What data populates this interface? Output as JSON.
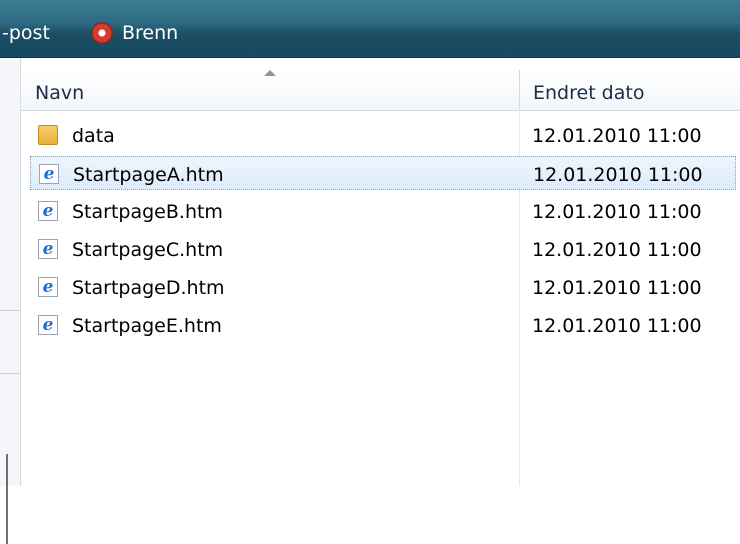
{
  "toolbar": {
    "post_label": "-post",
    "burn_label": "Brenn"
  },
  "columns": {
    "name": "Navn",
    "date": "Endret dato"
  },
  "rows": [
    {
      "name": "data",
      "date": "12.01.2010 11:00",
      "icon": "folder-icon",
      "selected": false
    },
    {
      "name": "StartpageA.htm",
      "date": "12.01.2010 11:00",
      "icon": "ie-document-icon",
      "selected": true
    },
    {
      "name": "StartpageB.htm",
      "date": "12.01.2010 11:00",
      "icon": "ie-document-icon",
      "selected": false
    },
    {
      "name": "StartpageC.htm",
      "date": "12.01.2010 11:00",
      "icon": "ie-document-icon",
      "selected": false
    },
    {
      "name": "StartpageD.htm",
      "date": "12.01.2010 11:00",
      "icon": "ie-document-icon",
      "selected": false
    },
    {
      "name": "StartpageE.htm",
      "date": "12.01.2010 11:00",
      "icon": "ie-document-icon",
      "selected": false
    }
  ],
  "colors": {
    "toolbar": "#2e6a82",
    "selection": "#dcecfb",
    "ie_blue": "#1c6fd0"
  }
}
